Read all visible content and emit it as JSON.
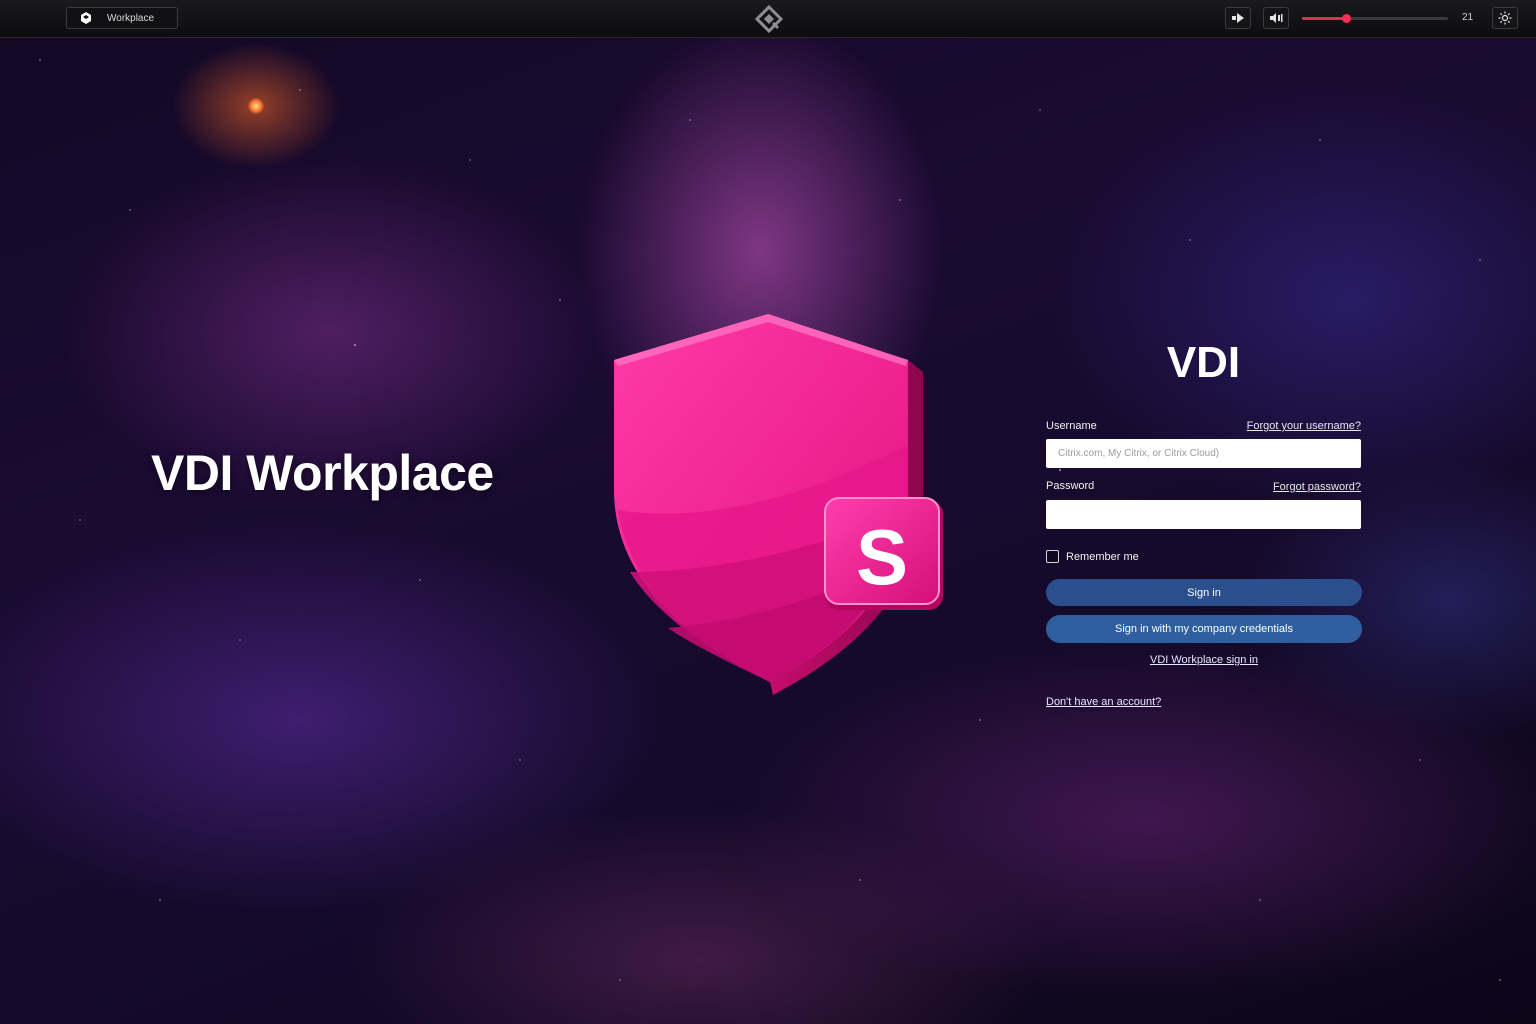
{
  "topbar": {
    "app_label": "Workplace",
    "counter": "21",
    "slider_value": 0.3
  },
  "hero": {
    "title": "VDI Workplace",
    "badge_letter": "S",
    "brand_color": "#ff1f9a"
  },
  "login": {
    "title": "VDI",
    "username_label": "Username",
    "forgot_username": "Forgot your username?",
    "username_placeholder": "Citrix.com, My Citrix, or Citrix Cloud)",
    "password_label": "Password",
    "forgot_password": "Forgot password?",
    "remember_label": "Remember me",
    "signin_label": "Sign in",
    "company_label": "Sign in with my company credentials",
    "workplace_link": "VDI Workplace sign in",
    "no_account_link": "Don't have an account?",
    "primary_color": "#2b4f8c"
  }
}
